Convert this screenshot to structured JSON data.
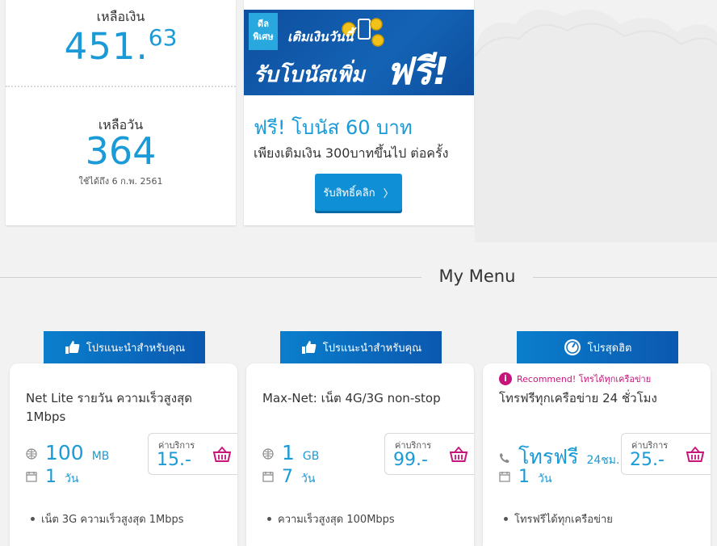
{
  "balance": {
    "label": "เหลือเงิน",
    "integer": "451.",
    "decimal": "63"
  },
  "days": {
    "label": "เหลือวัน",
    "value": "364",
    "valid_until": "ใช้ได้ถึง 6 ก.พ. 2561"
  },
  "promo": {
    "badge": "ดีล พิเศษ",
    "banner_line1": "เติมเงินวันนี้",
    "banner_line2": "รับโบนัสเพิ่ม",
    "banner_free": "ฟรี!",
    "title": "ฟรี! โบนัส 60 บาท",
    "description": "เพียงเติมเงิน 300บาทขึ้นไป ต่อครั้ง",
    "claim_label": "รับสิทธิ์คลิก",
    "claim_arrow": "〉"
  },
  "menu": {
    "title": "My Menu"
  },
  "packages": [
    {
      "header": "โปรแนะนำสำหรับคุณ",
      "header_icon": "thumbs-up-icon",
      "name": "Net Lite รายวัน ความเร็วสูงสุด 1Mbps",
      "amount": "100",
      "amount_unit": "MB",
      "amount_icon": "globe-icon",
      "duration": "1",
      "duration_unit": "วัน",
      "price_label": "ค่าบริการ",
      "price": "15.-",
      "bullet": "เน็ต 3G ความเร็วสูงสุด 1Mbps"
    },
    {
      "header": "โปรแนะนำสำหรับคุณ",
      "header_icon": "thumbs-up-icon",
      "name": "Max-Net: เน็ต 4G/3G non-stop",
      "amount": "1",
      "amount_unit": "GB",
      "amount_icon": "globe-icon",
      "duration": "7",
      "duration_unit": "วัน",
      "price_label": "ค่าบริการ",
      "price": "99.-",
      "bullet": "ความเร็วสูงสุด 100Mbps"
    },
    {
      "header": "โปรสุดฮิต",
      "header_icon": "gauge-icon",
      "recommend": "Recommend! โทรได้ทุกเครือข่าย",
      "name": "โทรฟรีทุกเครือข่าย 24 ชั่วโมง",
      "amount": "โทรฟรี",
      "amount_unit": "24ชม.",
      "amount_icon": "phone-icon",
      "duration": "1",
      "duration_unit": "วัน",
      "price_label": "ค่าบริการ",
      "price": "25.-",
      "bullet": "โทรฟรีได้ทุกเครือข่าย"
    }
  ],
  "colors": {
    "accent_blue": "#1a9ad6",
    "header_blue": "#0b58b0",
    "magenta": "#c8157b"
  }
}
